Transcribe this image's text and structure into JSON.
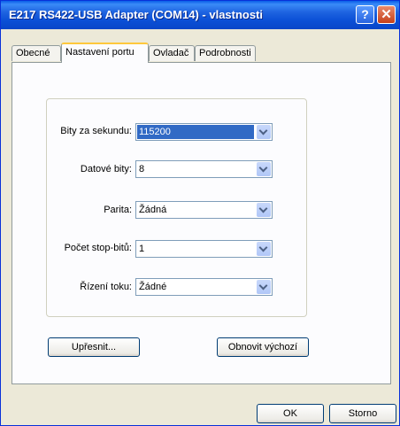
{
  "window": {
    "title": "E217 RS422-USB Adapter (COM14)  - vlastnosti",
    "help_glyph": "?",
    "close_glyph": "✕"
  },
  "tabs": [
    {
      "label": "Obecné",
      "active": false
    },
    {
      "label": "Nastavení portu",
      "active": true
    },
    {
      "label": "Ovladač",
      "active": false
    },
    {
      "label": "Podrobnosti",
      "active": false
    }
  ],
  "settings": {
    "bits_per_second": {
      "label": "Bity za sekundu:",
      "value": "115200"
    },
    "data_bits": {
      "label": "Datové bity:",
      "value": "8"
    },
    "parity": {
      "label": "Parita:",
      "value": "Žádná"
    },
    "stop_bits": {
      "label": "Počet stop-bitů:",
      "value": "1"
    },
    "flow_control": {
      "label": "Řízení toku:",
      "value": "Žádné"
    }
  },
  "buttons": {
    "advanced": "Upřesnit...",
    "restore_defaults": "Obnovit výchozí",
    "ok": "OK",
    "cancel": "Storno"
  },
  "colors": {
    "titlebar": "#0A5EE8",
    "selection": "#316AC5",
    "active_tab_accent": "#FFC83C"
  }
}
